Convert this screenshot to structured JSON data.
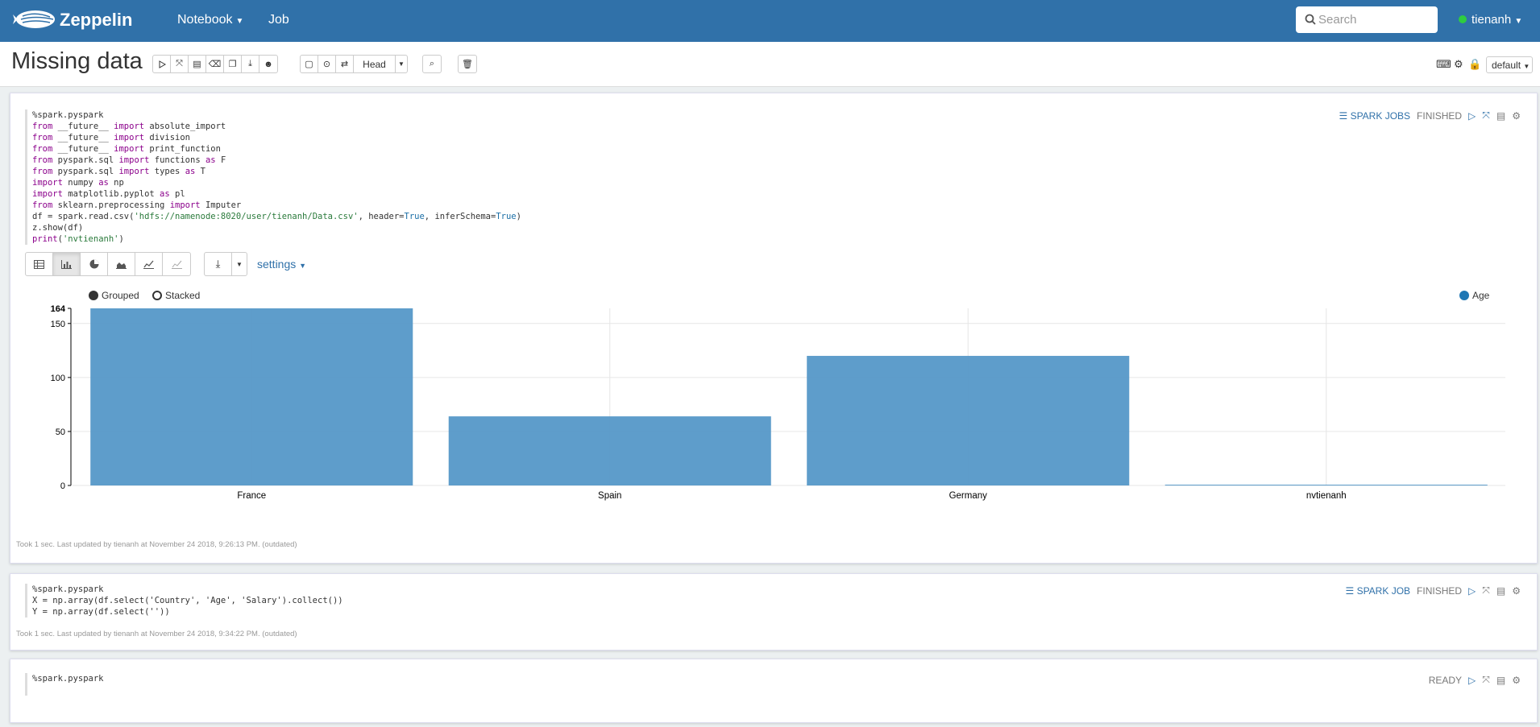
{
  "nav": {
    "brand": "Zeppelin",
    "notebook": "Notebook",
    "job": "Job",
    "search_placeholder": "Search",
    "user": "tienanh"
  },
  "header": {
    "title": "Missing data",
    "head_select": "Head",
    "interpreter": "default"
  },
  "paragraphs": [
    {
      "status": "FINISHED",
      "spark_label": "SPARK JOBS",
      "code": [
        [
          [
            "t",
            "%spark.pyspark"
          ]
        ],
        [
          [
            "k",
            "from"
          ],
          [
            "t",
            " __future__ "
          ],
          [
            "k",
            "import"
          ],
          [
            "t",
            " absolute_import"
          ]
        ],
        [
          [
            "k",
            "from"
          ],
          [
            "t",
            " __future__ "
          ],
          [
            "k",
            "import"
          ],
          [
            "t",
            " division"
          ]
        ],
        [
          [
            "k",
            "from"
          ],
          [
            "t",
            " __future__ "
          ],
          [
            "k",
            "import"
          ],
          [
            "t",
            " print_function"
          ]
        ],
        [
          [
            "k",
            "from"
          ],
          [
            "t",
            " pyspark.sql "
          ],
          [
            "k",
            "import"
          ],
          [
            "t",
            " functions "
          ],
          [
            "k",
            "as"
          ],
          [
            "t",
            " F"
          ]
        ],
        [
          [
            "k",
            "from"
          ],
          [
            "t",
            " pyspark.sql "
          ],
          [
            "k",
            "import"
          ],
          [
            "t",
            " types "
          ],
          [
            "k",
            "as"
          ],
          [
            "t",
            " T"
          ]
        ],
        [
          [
            "k",
            "import"
          ],
          [
            "t",
            " numpy "
          ],
          [
            "k",
            "as"
          ],
          [
            "t",
            " np"
          ]
        ],
        [
          [
            "k",
            "import"
          ],
          [
            "t",
            " matplotlib.pyplot "
          ],
          [
            "k",
            "as"
          ],
          [
            "t",
            " pl"
          ]
        ],
        [
          [
            "k",
            "from"
          ],
          [
            "t",
            " sklearn.preprocessing "
          ],
          [
            "k",
            "import"
          ],
          [
            "t",
            " Imputer"
          ]
        ],
        [
          [
            "t",
            "df = spark.read.csv("
          ],
          [
            "s",
            "'hdfs://namenode:8020/user/tienanh/Data.csv'"
          ],
          [
            "t",
            ", header="
          ],
          [
            "b",
            "True"
          ],
          [
            "t",
            ", inferSchema="
          ],
          [
            "b",
            "True"
          ],
          [
            "t",
            ")"
          ]
        ],
        [
          [
            "t",
            "z.show(df)"
          ]
        ],
        [
          [
            "k",
            "print"
          ],
          [
            "t",
            "("
          ],
          [
            "s",
            "'nvtienanh'"
          ],
          [
            "t",
            ")"
          ]
        ]
      ],
      "settings_label": "settings",
      "footer": "Took 1 sec. Last updated by tienanh at November 24 2018, 9:26:13 PM. (outdated)"
    },
    {
      "status": "FINISHED",
      "spark_label": "SPARK JOB",
      "code": [
        [
          [
            "t",
            "%spark.pyspark"
          ]
        ],
        [
          [
            "t",
            "X = np.array(df.select('Country', 'Age', 'Salary').collect())"
          ]
        ],
        [
          [
            "t",
            "Y = np.array(df.select(''))"
          ]
        ]
      ],
      "footer": "Took 1 sec. Last updated by tienanh at November 24 2018, 9:34:22 PM. (outdated)"
    },
    {
      "status": "READY",
      "code": [
        [
          [
            "t",
            "%spark.pyspark"
          ]
        ]
      ]
    }
  ],
  "legend": {
    "grouped": "Grouped",
    "stacked": "Stacked"
  },
  "colors": {
    "navbar": "#3071a9",
    "bar": "#5598c8"
  },
  "chart_data": {
    "type": "bar",
    "categories": [
      "France",
      "Spain",
      "Germany",
      "nvtienanh"
    ],
    "series": [
      {
        "name": "Age",
        "values": [
          164,
          64,
          120,
          0
        ],
        "color": "#5598c8"
      }
    ],
    "ylim": [
      0,
      164
    ],
    "yticks": [
      0,
      50,
      100,
      150,
      164
    ],
    "grid": true,
    "legend_position": "top-right"
  }
}
